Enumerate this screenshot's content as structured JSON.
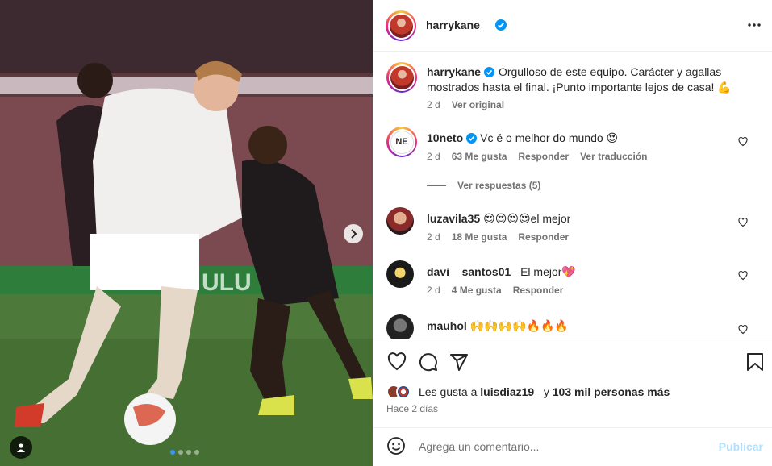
{
  "post": {
    "author": "harrykane",
    "more_icon": "more-horizontal-icon",
    "caption": "Orgulloso de este equipo. Carácter y agallas mostrados hasta el final. ¡Punto importante lejos de casa! 💪",
    "caption_time": "2 d",
    "caption_translate": "Ver original"
  },
  "comments": [
    {
      "user": "10neto",
      "text": "Vc é o melhor do mundo 😍",
      "time": "2 d",
      "likes": "63 Me gusta",
      "reply": "Responder",
      "translate": "Ver traducción"
    },
    {
      "user": "luzavila35",
      "text": "😍😍😍😍el mejor",
      "time": "2 d",
      "likes": "18 Me gusta",
      "reply": "Responder"
    },
    {
      "user": "davi__santos01_",
      "text": "El mejor💖",
      "time": "2 d",
      "likes": "4 Me gusta",
      "reply": "Responder"
    },
    {
      "user": "mauhol",
      "text": "🙌🙌🙌🙌🔥🔥🔥"
    }
  ],
  "replies_label": "Ver respuestas (5)",
  "likes": {
    "prefix": "Les gusta a",
    "user": "luisdiaz19_",
    "joiner": "y",
    "others": "103 mil personas más"
  },
  "posted_ago": "Hace 2 días",
  "composer": {
    "placeholder": "Agrega un comentario...",
    "submit": "Publicar"
  },
  "carousel": {
    "total": 4,
    "active": 0
  },
  "colors": {
    "accent": "#0095f6",
    "verified": "#0095f6",
    "submit_disabled": "#b2dffc"
  }
}
